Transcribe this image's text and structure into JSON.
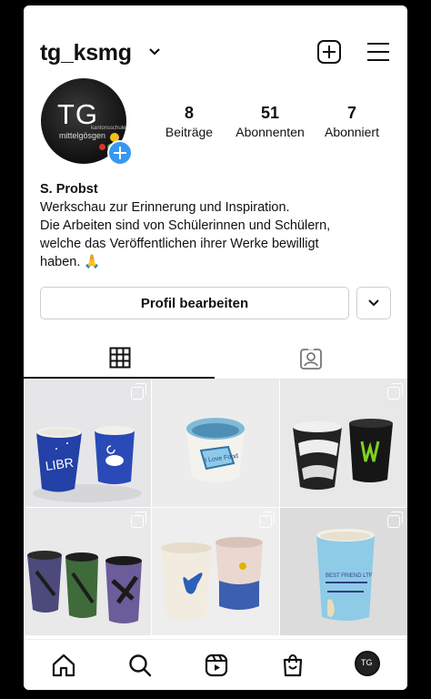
{
  "header": {
    "username": "tg_ksmg"
  },
  "profile": {
    "avatar_text": "TG",
    "avatar_subtext": "mittelgösgen",
    "avatar_small": "kantonsschule"
  },
  "stats": [
    {
      "value": "8",
      "label": "Beiträge"
    },
    {
      "value": "51",
      "label": "Abonnenten"
    },
    {
      "value": "7",
      "label": "Abonniert"
    }
  ],
  "bio": {
    "name": "S. Probst",
    "line1": "Werkschau zur Erinnerung und Inspiration.",
    "line2": "Die Arbeiten sind von Schülerinnen und Schülern,",
    "line3": "welche das Veröffentlichen ihrer Werke bewilligt",
    "line4": "haben. 🙏"
  },
  "actions": {
    "edit_profile": "Profil bearbeiten"
  },
  "posts": [
    {
      "caption": "LIBR",
      "bg": "#e9e9ea"
    },
    {
      "caption": "I Love Food",
      "bg": "#ececec"
    },
    {
      "caption": "",
      "bg": "#e8e8e8"
    },
    {
      "caption": "",
      "bg": "#e9e9e9"
    },
    {
      "caption": "",
      "bg": "#eeeeee"
    },
    {
      "caption": "BEST FRIEND LTF",
      "bg": "#dcdcdc"
    }
  ],
  "colors": {
    "accent": "#3897f0"
  }
}
